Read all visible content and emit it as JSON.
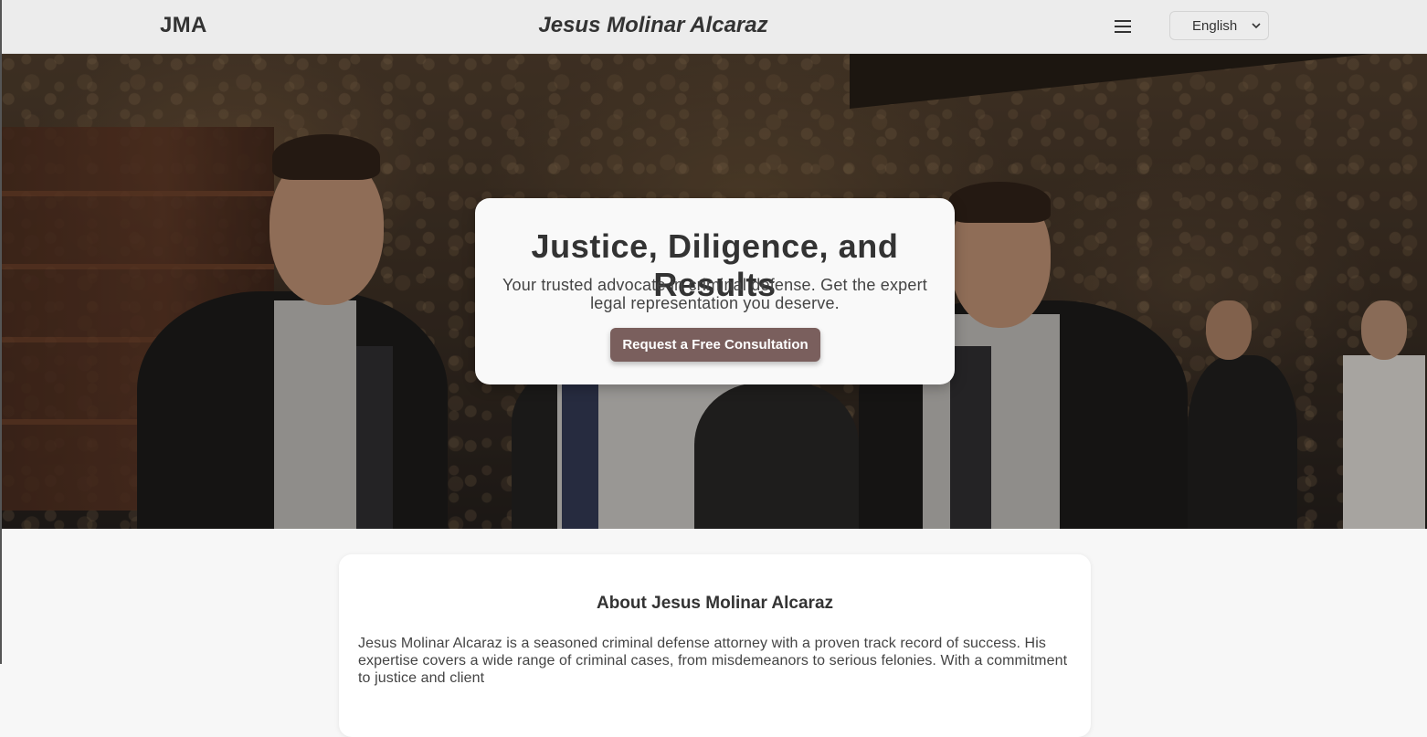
{
  "header": {
    "logo": "JMA",
    "title": "Jesus Molinar Alcaraz",
    "menu_icon": "hamburger-menu-icon",
    "language": {
      "selected": "English",
      "icon": "chevron-down-icon"
    }
  },
  "hero": {
    "background": "photo of men in suits at a wedding reception in a stone-walled room",
    "heading": "Justice, Diligence, and Results",
    "subheading": "Your trusted advocate in criminal defense. Get the expert legal representation you deserve.",
    "cta_label": "Request a Free Consultation"
  },
  "about": {
    "title": "About Jesus Molinar Alcaraz",
    "text": "Jesus Molinar Alcaraz is a seasoned criminal defense attorney with a proven track record of success. His expertise covers a wide range of criminal cases, from misdemeanors to serious felonies. With a commitment to justice and client"
  },
  "colors": {
    "header_bg": "#ececec",
    "page_bg": "#f7f7f7",
    "cta_bg": "#7a5f5d",
    "text": "#333333"
  }
}
